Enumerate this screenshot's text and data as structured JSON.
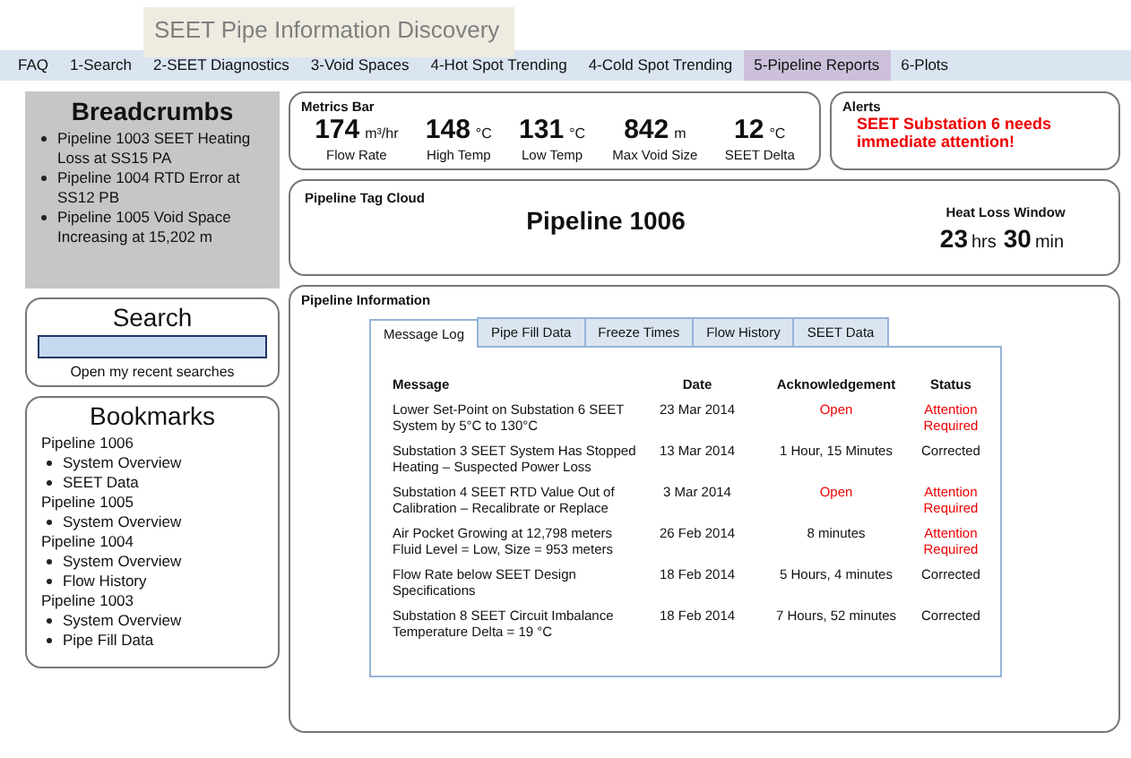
{
  "app_title": "SEET Pipe Information Discovery",
  "nav": [
    {
      "label": "FAQ",
      "selected": false
    },
    {
      "label": "1-Search",
      "selected": false
    },
    {
      "label": "2-SEET Diagnostics",
      "selected": false
    },
    {
      "label": "3-Void Spaces",
      "selected": false
    },
    {
      "label": "4-Hot Spot Trending",
      "selected": false
    },
    {
      "label": "4-Cold Spot Trending",
      "selected": false
    },
    {
      "label": "5-Pipeline Reports",
      "selected": true
    },
    {
      "label": "6-Plots",
      "selected": false
    }
  ],
  "breadcrumbs": {
    "title": "Breadcrumbs",
    "items": [
      "Pipeline 1003 SEET Heating Loss at SS15 PA",
      "Pipeline 1004 RTD Error at SS12 PB",
      "Pipeline 1005 Void Space Increasing at 15,202 m"
    ]
  },
  "search": {
    "title": "Search",
    "link": "Open my recent searches"
  },
  "bookmarks": {
    "title": "Bookmarks",
    "groups": [
      {
        "name": "Pipeline 1006",
        "items": [
          "System Overview",
          "SEET Data"
        ]
      },
      {
        "name": "Pipeline 1005",
        "items": [
          "System Overview"
        ]
      },
      {
        "name": "Pipeline 1004",
        "items": [
          "System Overview",
          "Flow History"
        ]
      },
      {
        "name": "Pipeline 1003",
        "items": [
          "System Overview",
          "Pipe Fill Data"
        ]
      }
    ]
  },
  "metrics": {
    "title": "Metrics Bar",
    "items": [
      {
        "value": "174",
        "unit": "m³/hr",
        "label": "Flow Rate"
      },
      {
        "value": "148",
        "unit": "°C",
        "label": "High Temp"
      },
      {
        "value": "131",
        "unit": "°C",
        "label": "Low Temp"
      },
      {
        "value": "842",
        "unit": "m",
        "label": "Max Void Size"
      },
      {
        "value": "12",
        "unit": "°C",
        "label": "SEET Delta"
      }
    ]
  },
  "alerts": {
    "title": "Alerts",
    "message": "SEET Substation 6 needs immediate attention!"
  },
  "tag_cloud": {
    "title": "Pipeline Tag Cloud",
    "pipeline": "Pipeline 1006"
  },
  "heat_loss": {
    "title": "Heat Loss Window",
    "hours": "23",
    "hours_unit": "hrs",
    "minutes": "30",
    "minutes_unit": "min"
  },
  "info": {
    "title": "Pipeline Information",
    "tabs": [
      {
        "label": "Message Log",
        "selected": true
      },
      {
        "label": "Pipe Fill Data",
        "selected": false
      },
      {
        "label": "Freeze Times",
        "selected": false
      },
      {
        "label": "Flow History",
        "selected": false
      },
      {
        "label": "SEET Data",
        "selected": false
      }
    ],
    "columns": [
      "Message",
      "Date",
      "Acknowledgement",
      "Status"
    ],
    "rows": [
      {
        "message": "Lower Set-Point on Substation 6 SEET System by 5°C to 130°C",
        "date": "23 Mar 2014",
        "ack": "Open",
        "ack_alert": true,
        "status": "Attention Required",
        "status_alert": true
      },
      {
        "message": "Substation 3 SEET System Has Stopped Heating – Suspected Power Loss",
        "date": "13 Mar 2014",
        "ack": "1 Hour, 15 Minutes",
        "ack_alert": false,
        "status": "Corrected",
        "status_alert": false
      },
      {
        "message": "Substation 4 SEET RTD Value Out of Calibration – Recalibrate or Replace",
        "date": "3 Mar 2014",
        "ack": "Open",
        "ack_alert": true,
        "status": "Attention Required",
        "status_alert": true
      },
      {
        "message": "Air Pocket Growing at 12,798 meters Fluid Level = Low, Size = 953 meters",
        "date": "26 Feb 2014",
        "ack": "8 minutes",
        "ack_alert": false,
        "status": "Attention Required",
        "status_alert": true
      },
      {
        "message": "Flow Rate below SEET Design Specifications",
        "date": "18 Feb 2014",
        "ack": "5 Hours, 4 minutes",
        "ack_alert": false,
        "status": "Corrected",
        "status_alert": false
      },
      {
        "message": "Substation 8 SEET Circuit Imbalance Temperature Delta = 19 °C",
        "date": "18 Feb 2014",
        "ack": "7 Hours, 52 minutes",
        "ack_alert": false,
        "status": "Corrected",
        "status_alert": false
      }
    ]
  }
}
